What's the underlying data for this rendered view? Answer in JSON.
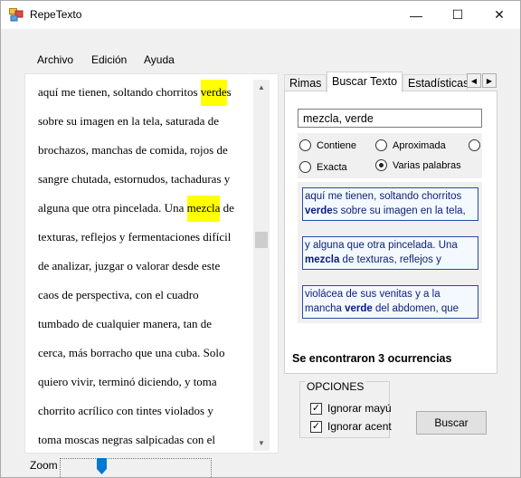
{
  "window": {
    "title": "RepeTexto",
    "minimize": "—",
    "maximize": "☐",
    "close": "✕"
  },
  "menu": [
    "Archivo",
    "Edición",
    "Ayuda"
  ],
  "editor": {
    "lines": [
      {
        "before": "aquí me tienen, soltando chorritos ",
        "match": "verde",
        "after": "s"
      },
      {
        "before": "sobre su imagen en la tela, saturada de",
        "match": "",
        "after": ""
      },
      {
        "before": "brochazos, manchas de comida, rojos de",
        "match": "",
        "after": ""
      },
      {
        "before": "sangre chutada, estornudos, tachaduras y",
        "match": "",
        "after": ""
      },
      {
        "before": "alguna que otra pincelada. Una ",
        "match": "mezcla",
        "after": " de"
      },
      {
        "before": "texturas, reflejos y fermentaciones difícil",
        "match": "",
        "after": ""
      },
      {
        "before": "de analizar, juzgar o valorar desde este",
        "match": "",
        "after": ""
      },
      {
        "before": "caos de perspectiva, con el cuadro",
        "match": "",
        "after": ""
      },
      {
        "before": "tumbado de cualquier manera, tan de",
        "match": "",
        "after": ""
      },
      {
        "before": "cerca, más borracho que una cuba. Solo",
        "match": "",
        "after": ""
      },
      {
        "before": "quiero vivir, terminó diciendo, y toma",
        "match": "",
        "after": ""
      },
      {
        "before": "chorrito acrílico con tintes violados y",
        "match": "",
        "after": ""
      },
      {
        "before": "toma moscas negras salpicadas con el",
        "match": "",
        "after": ""
      }
    ]
  },
  "zoom": {
    "label": "Zoom",
    "level": 0.25
  },
  "tabs": [
    "Rimas",
    "Buscar Texto",
    "Estadísticas"
  ],
  "search": {
    "query": "mezcla, verde",
    "options": [
      "Contiene",
      "Aproximada",
      "",
      "Exacta",
      "Varias palabras"
    ],
    "selected": "Varias palabras"
  },
  "results": [
    {
      "l1_pre": "aquí me tienen, soltando chorritos",
      "l1_b": "",
      "l1_post": "",
      "l2_pre": "",
      "l2_b": "verde",
      "l2_post": "s sobre su imagen en la tela,"
    },
    {
      "l1_pre": "y alguna que otra pincelada. Una",
      "l1_b": "",
      "l1_post": "",
      "l2_pre": "",
      "l2_b": "mezcla",
      "l2_post": " de texturas, reflejos y"
    },
    {
      "l1_pre": "violácea de sus venitas y a la",
      "l1_b": "",
      "l1_post": "",
      "l2_pre": "mancha ",
      "l2_b": "verde",
      "l2_post": " del abdomen, que"
    }
  ],
  "found_text": "Se encontraron 3 ocurrencias",
  "opciones": {
    "title": "OPCIONES",
    "items": [
      {
        "label": "Ignorar mayúsculas",
        "checked": true
      },
      {
        "label": "Ignorar acentos",
        "checked": true
      }
    ]
  },
  "buscar_label": "Buscar",
  "colors": {
    "highlight": "#ffff00",
    "result_border": "#2b4aa8",
    "result_text": "#10217a"
  }
}
